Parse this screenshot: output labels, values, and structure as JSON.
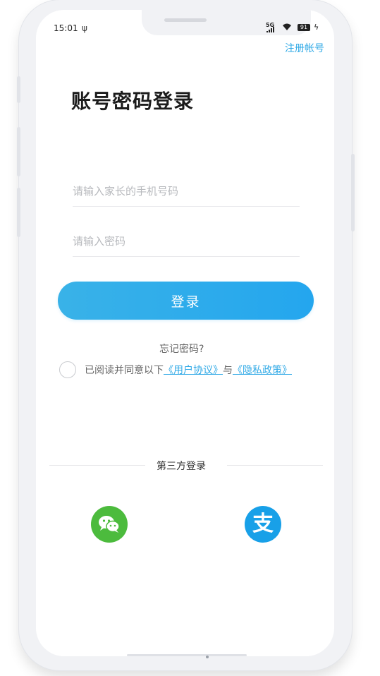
{
  "status_bar": {
    "time": "15:01",
    "network": "5G",
    "battery": "91"
  },
  "header": {
    "register_label": "注册帐号"
  },
  "page": {
    "title": "账号密码登录"
  },
  "form": {
    "phone_placeholder": "请输入家长的手机号码",
    "phone_value": "",
    "password_placeholder": "请输入密码",
    "password_value": "",
    "login_label": "登录",
    "forgot_label": "忘记密码?"
  },
  "agreement": {
    "prefix": "已阅读并同意以下",
    "user_agreement": "《用户协议》",
    "connector": "与",
    "privacy_policy": "《隐私政策》",
    "checked": false
  },
  "third_party": {
    "title": "第三方登录",
    "providers": [
      {
        "icon": "wechat-icon",
        "color": "#4cbb3d"
      },
      {
        "icon": "alipay-icon",
        "color": "#18a0e8"
      }
    ]
  },
  "colors": {
    "accent": "#2fa9e6",
    "button": "#24a6ee"
  }
}
